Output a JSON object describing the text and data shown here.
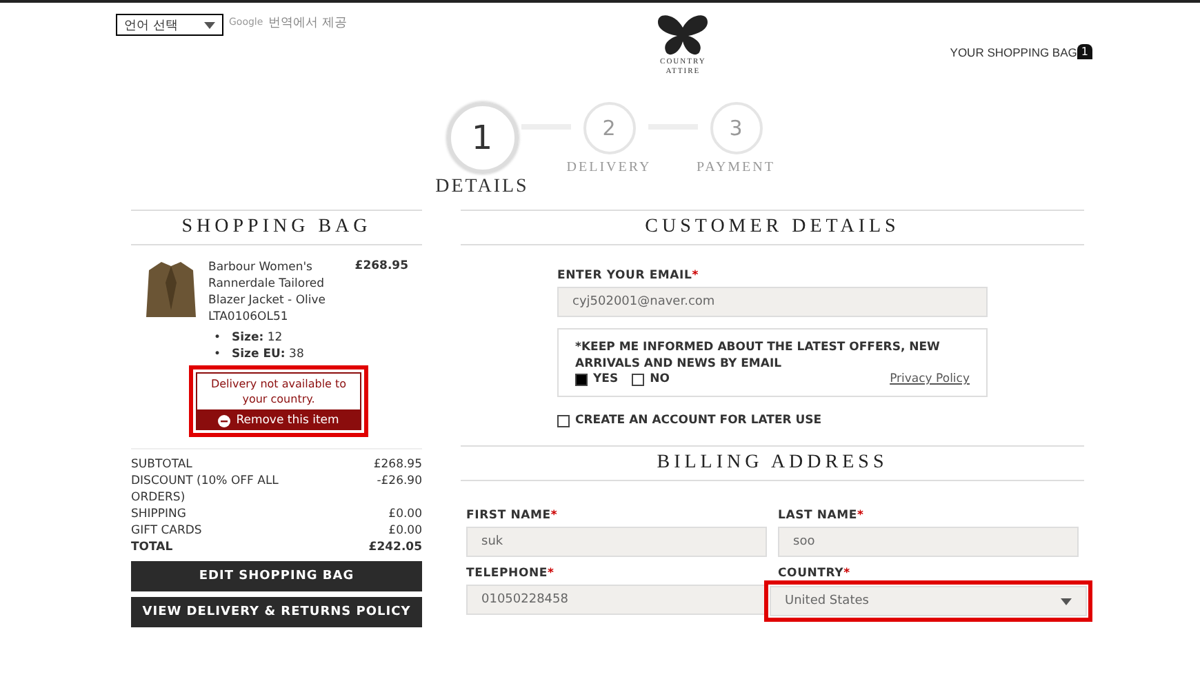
{
  "header": {
    "language_select": "언어 선택",
    "translate_brand": "Google",
    "translate_note": "번역에서 제공",
    "logo_text": [
      "COUNTRY",
      "ATTIRE"
    ],
    "bag_label": "YOUR SHOPPING BAG",
    "bag_count": "1"
  },
  "steps": [
    {
      "number": "1",
      "label": "DETAILS",
      "selected": true
    },
    {
      "number": "2",
      "label": "DELIVERY",
      "selected": false
    },
    {
      "number": "3",
      "label": "PAYMENT",
      "selected": false
    }
  ],
  "bag": {
    "title": "SHOPPING BAG",
    "item": {
      "name": "Barbour Women's Rannerdale Tailored Blazer Jacket - Olive LTA0106OL51",
      "price": "£268.95",
      "attributes": [
        {
          "bullet": "•",
          "label": "Size:",
          "value": "12"
        },
        {
          "bullet": "•",
          "label": "Size EU:",
          "value": "38"
        }
      ],
      "notice": "Delivery not available to your country.",
      "remove": "Remove this item"
    },
    "totals": [
      {
        "label": "SUBTOTAL",
        "value": "£268.95",
        "bold": false
      },
      {
        "label": "DISCOUNT (10% OFF ALL ORDERS)",
        "value": "-£26.90",
        "bold": false
      },
      {
        "label": "SHIPPING",
        "value": "£0.00",
        "bold": false
      },
      {
        "label": "GIFT CARDS",
        "value": "£0.00",
        "bold": false
      },
      {
        "label": "TOTAL",
        "value": "£242.05",
        "bold": true
      }
    ],
    "buttons": [
      "EDIT SHOPPING BAG",
      "VIEW DELIVERY & RETURNS POLICY"
    ]
  },
  "customer": {
    "title": "CUSTOMER DETAILS",
    "email_label": "ENTER YOUR EMAIL",
    "email_required_mark": "*",
    "email": "cyj502001@naver.com",
    "newsletter": {
      "question": "*KEEP ME INFORMED ABOUT THE LATEST OFFERS, NEW ARRIVALS AND NEWS BY EMAIL",
      "options": [
        {
          "label": "YES",
          "selected": true
        },
        {
          "label": "NO",
          "selected": false
        }
      ],
      "privacy_link": "Privacy Policy"
    },
    "create_account": {
      "label": "CREATE AN ACCOUNT FOR LATER USE",
      "checked": false
    }
  },
  "billing": {
    "title": "BILLING ADDRESS",
    "fields": [
      {
        "label": "FIRST NAME",
        "required_mark": "*",
        "value": "suk",
        "kind": "text"
      },
      {
        "label": "LAST NAME",
        "required_mark": "*",
        "value": "soo",
        "kind": "text"
      },
      {
        "label": "TELEPHONE",
        "required_mark": "*",
        "value": "01050228458",
        "kind": "text"
      },
      {
        "label": "COUNTRY",
        "required_mark": "*",
        "value": "United States",
        "kind": "select"
      }
    ]
  }
}
